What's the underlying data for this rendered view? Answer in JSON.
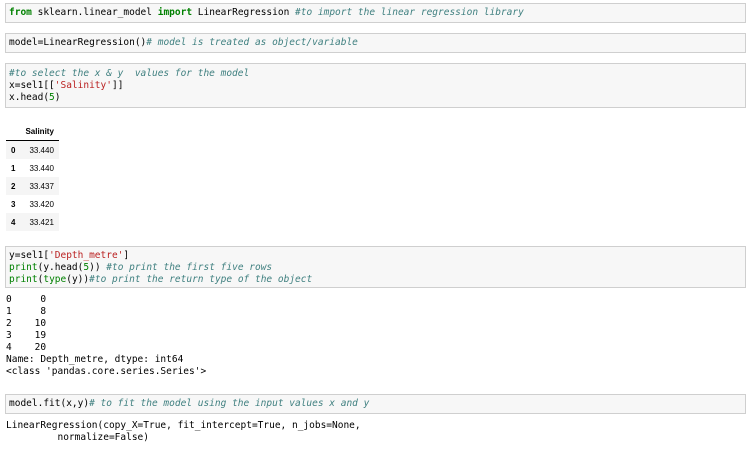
{
  "cells": {
    "c1": {
      "kw_from": "from",
      "module": " sklearn.linear_model ",
      "kw_import": "import",
      "cls": " LinearRegression ",
      "comment": "#to import the linear regression library"
    },
    "c2": {
      "code": "model=LinearRegression()",
      "comment": "# model is treated as object/variable"
    },
    "c3": {
      "comment": "#to select the x & y  values for the model",
      "pre": "x=sel1[[",
      "str": "'Salinity'",
      "post": "]]",
      "head": "x.head(",
      "num": "5",
      "close": ")"
    },
    "c4": {
      "pre": "y=sel1[",
      "str": "'Depth_metre'",
      "post": "]",
      "print1_fn": "print",
      "print1_mid": "(y.head(",
      "print1_num": "5",
      "print1_end": ")) ",
      "print1_comment": "#to print the first five rows",
      "print2_fn": "print",
      "print2_open": "(",
      "print2_type": "type",
      "print2_end": "(y))",
      "print2_comment": "#to print the return type of the object"
    },
    "c5": {
      "code": "model.fit(x,y)",
      "comment": "# to fit the model using the input values x and y"
    }
  },
  "dataframe": {
    "header": "Salinity",
    "rows": [
      {
        "index": "0",
        "value": "33.440"
      },
      {
        "index": "1",
        "value": "33.440"
      },
      {
        "index": "2",
        "value": "33.437"
      },
      {
        "index": "3",
        "value": "33.420"
      },
      {
        "index": "4",
        "value": "33.421"
      }
    ]
  },
  "series_output": {
    "rows": [
      "0     0",
      "1     8",
      "2    10",
      "3    19",
      "4    20"
    ],
    "footer": "Name: Depth_metre, dtype: int64",
    "type_line": "<class 'pandas.core.series.Series'>"
  },
  "fit_output": {
    "line1": "LinearRegression(copy_X=True, fit_intercept=True, n_jobs=None,",
    "line2": "         normalize=False)"
  }
}
